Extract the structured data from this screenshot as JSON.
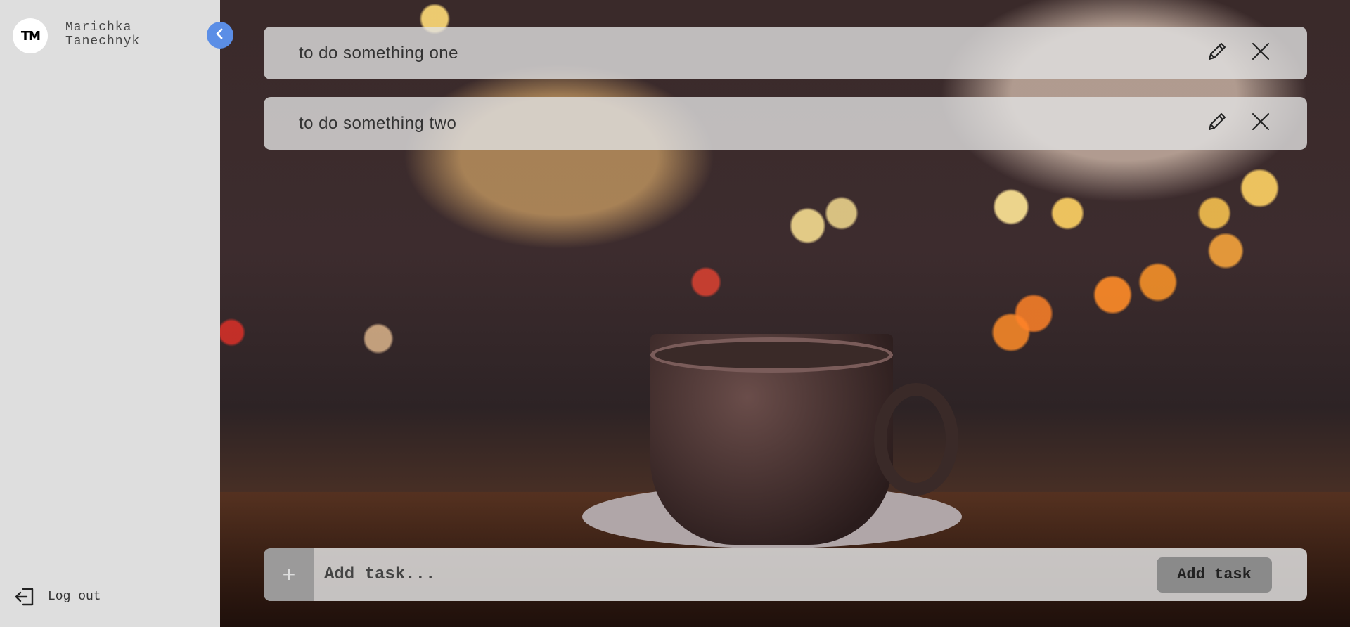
{
  "sidebar": {
    "avatar_initials": "TM",
    "username": "Marichka Tanechnyk",
    "logout_label": "Log out",
    "logout_icon": "logout-icon"
  },
  "collapse_button": {
    "icon": "chevron-left-icon",
    "color": "#5b8ee6"
  },
  "tasks": [
    {
      "text": "to do something one"
    },
    {
      "text": "to do something two"
    }
  ],
  "add_task": {
    "plus_symbol": "+",
    "placeholder": "Add task...",
    "button_label": "Add task"
  }
}
